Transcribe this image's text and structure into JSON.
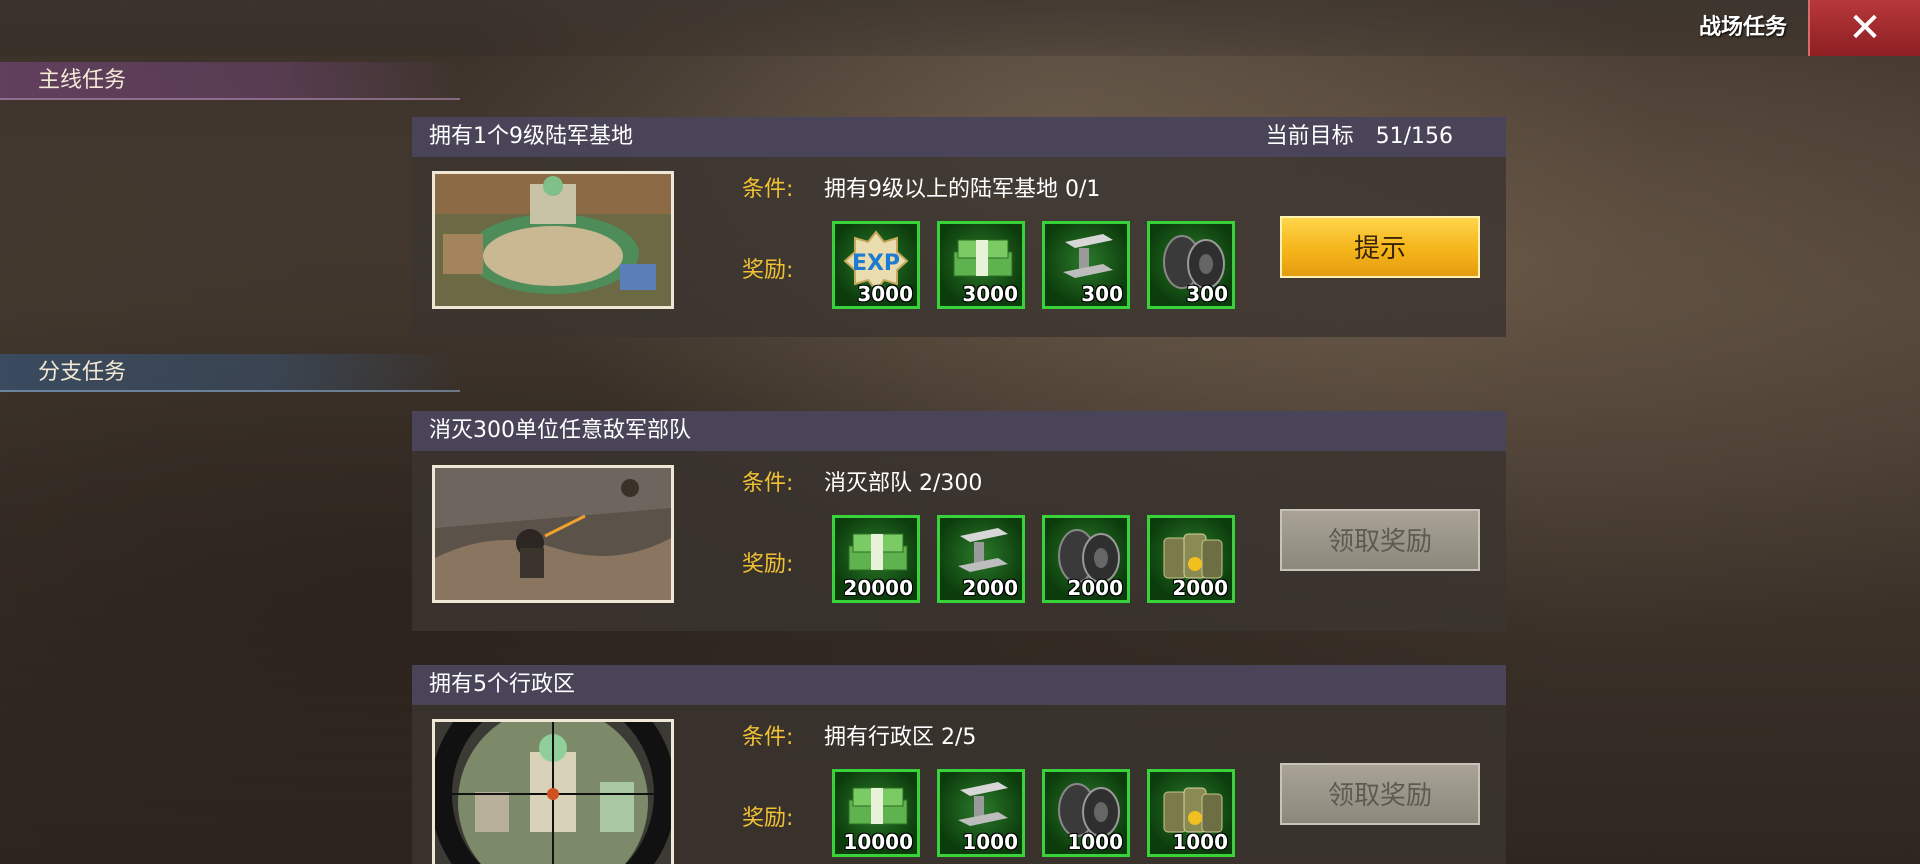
{
  "header": {
    "title": "战场任务",
    "close_icon": "close-icon"
  },
  "sections": {
    "main": "主线任务",
    "branch": "分支任务"
  },
  "labels": {
    "condition": "条件:",
    "reward": "奖励:"
  },
  "tasks": [
    {
      "title": "拥有1个9级陆军基地",
      "target_label": "当前目标",
      "target_value": "51/156",
      "condition": "拥有9级以上的陆军基地 0/1",
      "rewards": [
        {
          "icon": "exp-icon",
          "amount": "3000"
        },
        {
          "icon": "cash-icon",
          "amount": "3000"
        },
        {
          "icon": "steel-icon",
          "amount": "300"
        },
        {
          "icon": "rubber-tire-icon",
          "amount": "300"
        }
      ],
      "button": "提示"
    },
    {
      "title": "消灭300单位任意敌军部队",
      "condition": "消灭部队 2/300",
      "rewards": [
        {
          "icon": "cash-icon",
          "amount": "20000"
        },
        {
          "icon": "steel-icon",
          "amount": "2000"
        },
        {
          "icon": "rubber-tire-icon",
          "amount": "2000"
        },
        {
          "icon": "oil-barrel-icon",
          "amount": "2000"
        }
      ],
      "button": "领取奖励"
    },
    {
      "title": "拥有5个行政区",
      "condition": "拥有行政区 2/5",
      "rewards": [
        {
          "icon": "cash-icon",
          "amount": "10000"
        },
        {
          "icon": "steel-icon",
          "amount": "1000"
        },
        {
          "icon": "rubber-tire-icon",
          "amount": "1000"
        },
        {
          "icon": "oil-barrel-icon",
          "amount": "1000"
        }
      ],
      "button": "领取奖励"
    }
  ]
}
